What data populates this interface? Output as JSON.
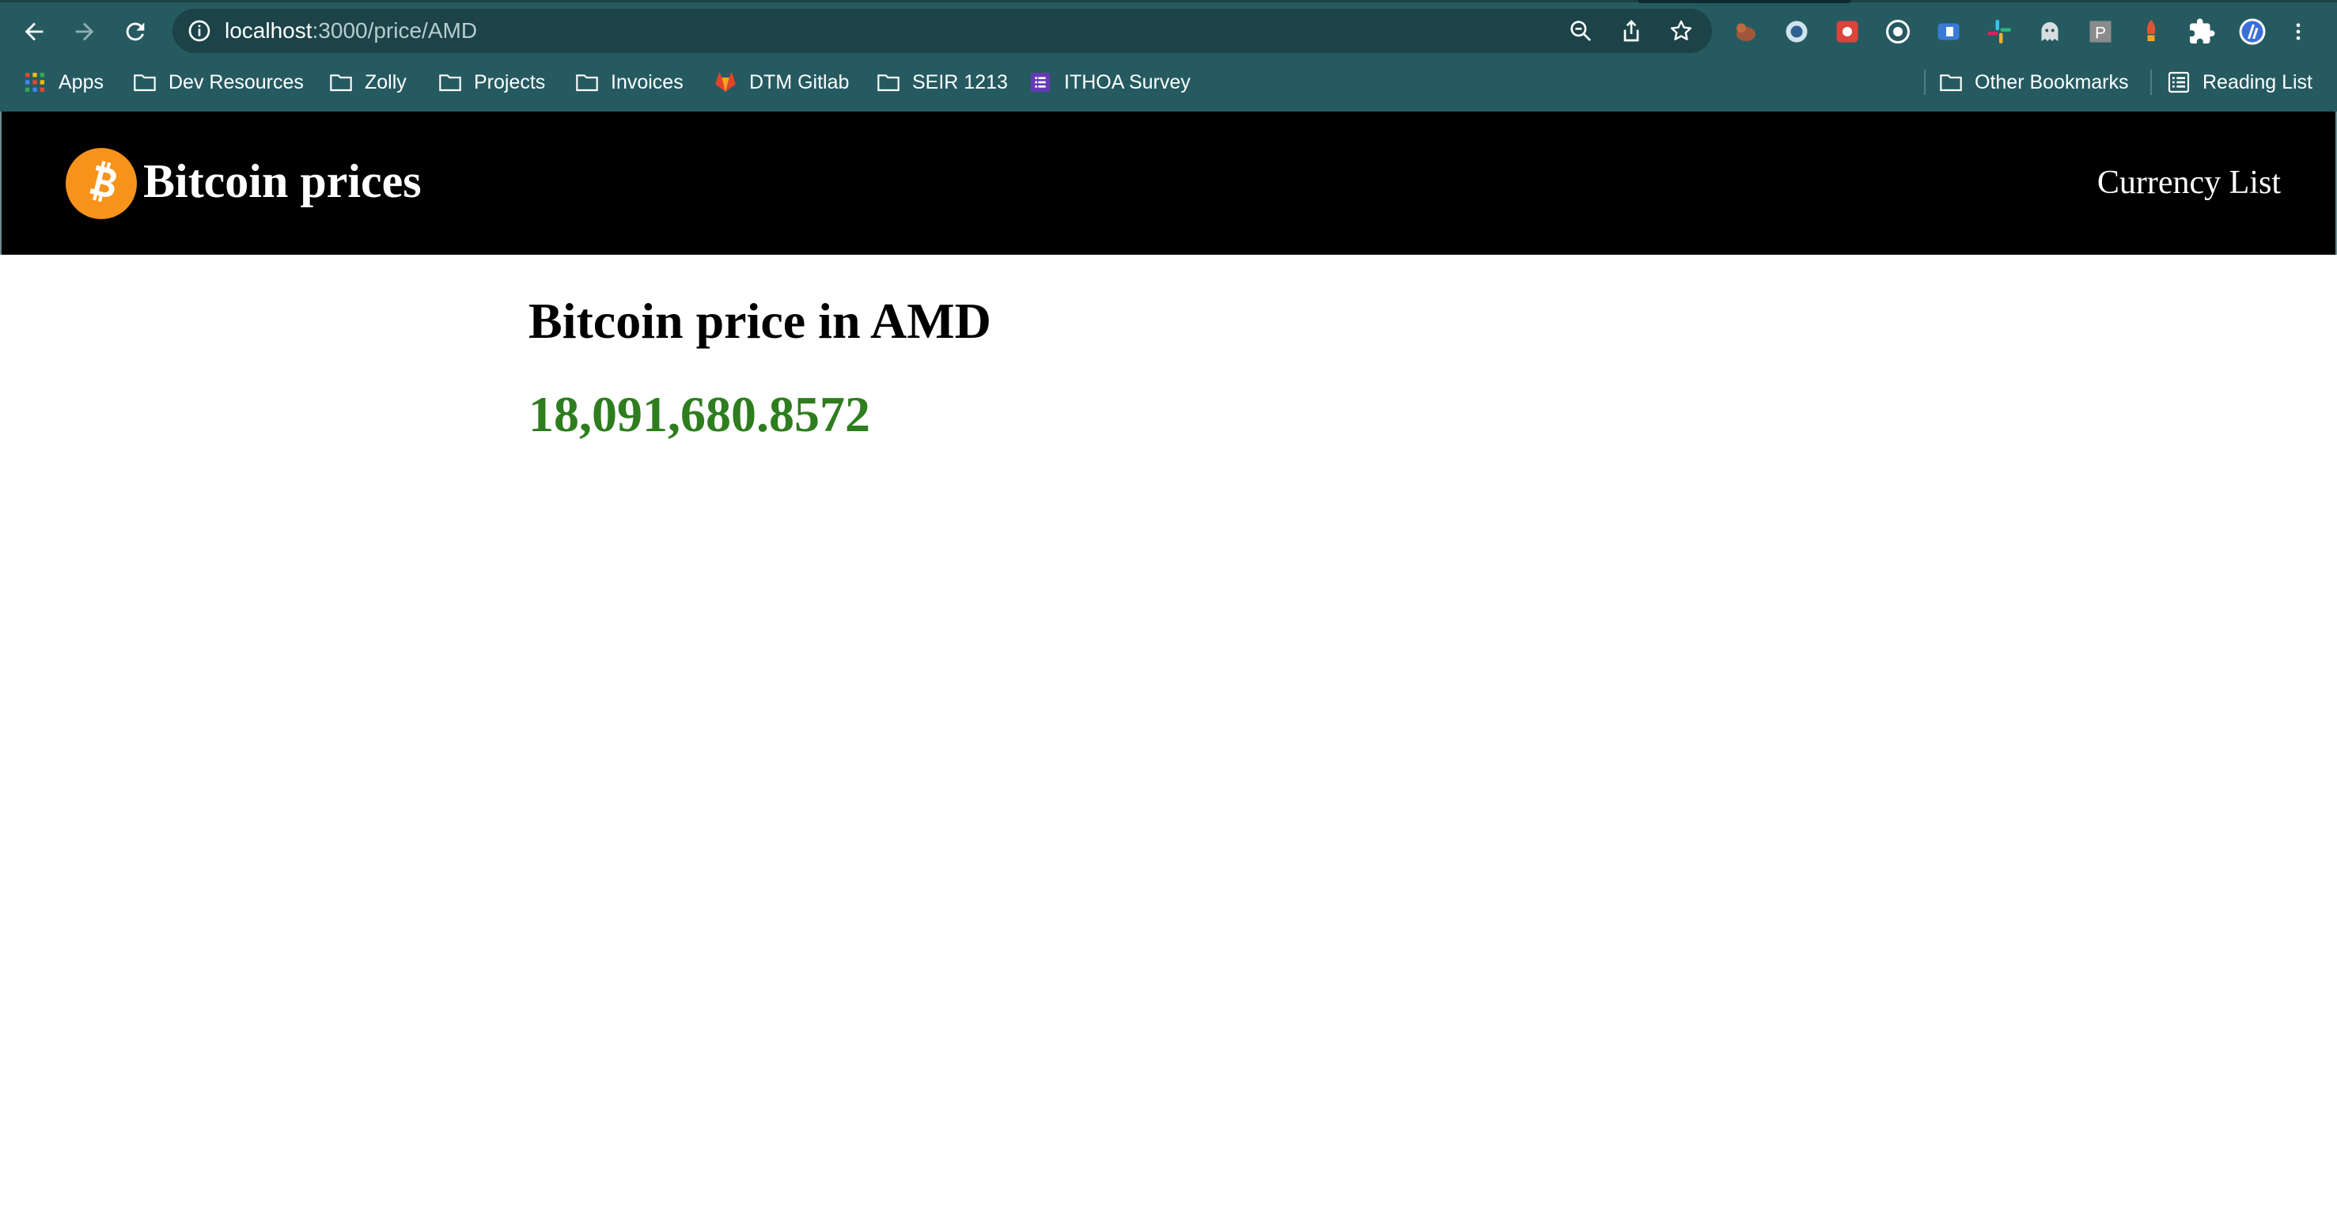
{
  "browser": {
    "url_host": "localhost",
    "url_path": ":3000/price/AMD",
    "bookmarks": [
      {
        "label": "Apps",
        "icon": "apps-grid-icon"
      },
      {
        "label": "Dev Resources",
        "icon": "folder-icon"
      },
      {
        "label": "Zolly",
        "icon": "folder-icon"
      },
      {
        "label": "Projects",
        "icon": "folder-icon"
      },
      {
        "label": "Invoices",
        "icon": "folder-icon"
      },
      {
        "label": "DTM Gitlab",
        "icon": "gitlab-icon"
      },
      {
        "label": "SEIR 1213",
        "icon": "folder-icon"
      },
      {
        "label": "ITHOA Survey",
        "icon": "forms-icon"
      }
    ],
    "other_bookmarks": "Other Bookmarks",
    "reading_list": "Reading List",
    "extension_badge": "P"
  },
  "site": {
    "brand": "Bitcoin prices",
    "nav_link": "Currency List"
  },
  "main": {
    "heading": "Bitcoin price in AMD",
    "price": "18,091,680.8572"
  },
  "colors": {
    "chrome": "#265a61",
    "header": "#000000",
    "bitcoin_orange": "#f7931a",
    "price_green": "#2e7d1e"
  }
}
